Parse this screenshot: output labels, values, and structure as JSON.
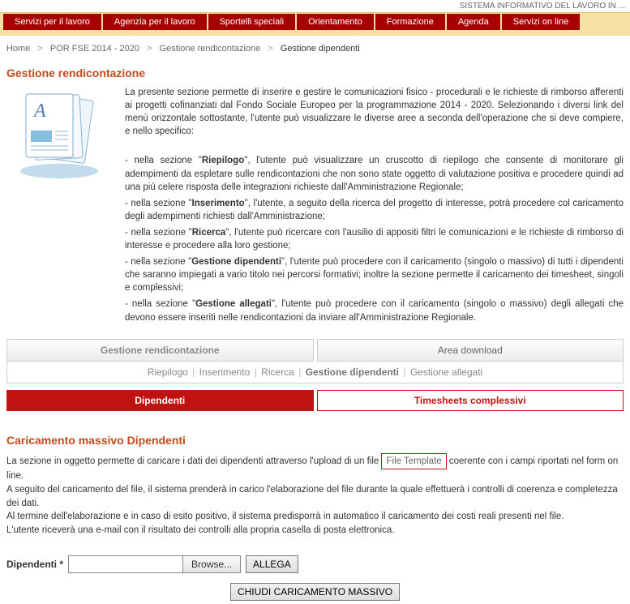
{
  "system_banner": "SISTEMA INFORMATIVO DEL LAVORO IN ...",
  "main_nav": [
    "Servizi per il lavoro",
    "Agenzia per il lavoro",
    "Sportelli speciali",
    "Orientamento",
    "Formazione",
    "Agenda",
    "Servizi on line"
  ],
  "breadcrumb": {
    "items": [
      "Home",
      "POR FSE 2014 - 2020",
      "Gestione rendicontazione"
    ],
    "current": "Gestione dipendenti"
  },
  "title": "Gestione rendicontazione",
  "intro": {
    "p1": "La presente sezione permette di inserire e gestire le comunicazioni fisico - procedurali e le richieste di rimborso afferenti ai progetti cofinanziati dal Fondo Sociale Europeo per la programmazione 2014 - 2020. Selezionando i diversi link del menù orizzontale sottostante, l'utente può visualizzare le diverse aree a seconda dell'operazione che si deve compiere, e nello specifico:",
    "b1pre": "- nella sezione \"",
    "b1bold": "Riepilogo",
    "b1post": "\", l'utente può visualizzare un cruscotto di riepilogo che consente di monitorare gli adempimenti da espletare sulle rendicontazioni che non sono state oggetto di valutazione positiva e procedere quindi ad una più celere risposta delle integrazioni richieste dall'Amministrazione Regionale;",
    "b2pre": "- nella sezione \"",
    "b2bold": "Inserimento",
    "b2post": "\", l'utente, a seguito della ricerca del progetto di interesse, potrà procedere col caricamento degli adempimenti richiesti dall'Amministrazione;",
    "b3pre": "- nella sezione \"",
    "b3bold": "Ricerca",
    "b3post": "\", l'utente può ricercare con l'ausilio di appositi filtri le comunicazioni e le richieste di rimborso di interesse e procedere alla loro gestione;",
    "b4pre": "- nella sezione \"",
    "b4bold": "Gestione dipendenti",
    "b4post": "\", l'utente può procedere con il caricamento (singolo o massivo) di tutti i dipendenti che saranno impiegati a vario titolo nei percorsi formativi; inoltre la sezione permette il caricamento dei timesheet, singoli e complessivi;",
    "b5pre": "- nella sezione \"",
    "b5bold": "Gestione allegati",
    "b5post": "\", l'utente può procedere con il caricamento (singolo o massivo) degli allegati che devono essere inseriti nelle rendicontazioni da inviare all'Amministrazione Regionale."
  },
  "tabs": {
    "a": "Gestione rendicontazione",
    "b": "Area download"
  },
  "subnav": {
    "riepilogo": "Riepilogo",
    "inserimento": "Inserimento",
    "ricerca": "Ricerca",
    "gestdip": "Gestione dipendenti",
    "gestall": "Gestione allegati"
  },
  "redtabs": {
    "active": "Dipendenti",
    "inactive": "Timesheets complessivi"
  },
  "subtitle": "Caricamento massivo Dipendenti",
  "body": {
    "l1a": "La sezione in oggetto permette di caricare i dati dei dipendenti attraverso l'upload di un file ",
    "tpl": "File Template",
    "l1b": " coerente con i campi riportati nel form on line.",
    "l2": "A seguito del caricamento del file, il sistema prenderà in carico l'elaborazione del file durante la quale effettuerà i controlli di coerenza e completezza dei dati.",
    "l3": "Al termine dell'elaborazione e in caso di esito positivo, il sistema predisporrà in automatico il caricamento dei costi reali presenti nel file.",
    "l4": "L'utente riceverà una e-mail con il risultato dei controlli alla propria casella di posta elettronica."
  },
  "form": {
    "label": "Dipendenti *",
    "browse": "Browse...",
    "attach": "ALLEGA",
    "close": "CHIUDI CARICAMENTO MASSIVO"
  }
}
